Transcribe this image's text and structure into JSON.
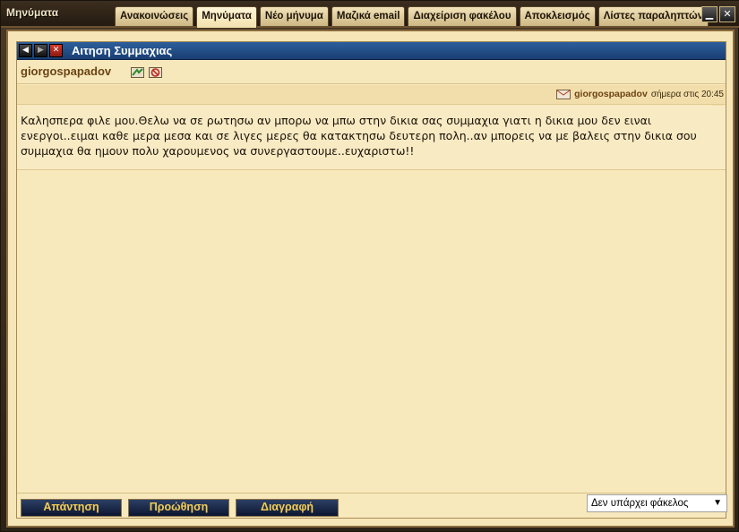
{
  "window": {
    "title": "Μηνύματα"
  },
  "tabs": [
    {
      "label": "Ανακοινώσεις"
    },
    {
      "label": "Μηνύματα",
      "active": true
    },
    {
      "label": "Νέο μήνυμα"
    },
    {
      "label": "Μαζικά email"
    },
    {
      "label": "Διαχείριση φακέλου"
    },
    {
      "label": "Αποκλεισμός"
    },
    {
      "label": "Λίστες παραληπτών"
    }
  ],
  "message": {
    "subject": "Αιτηση Συμμαχιας",
    "sender": "giorgospapadov",
    "post": {
      "author": "giorgospapadov",
      "time": "σήμερα στις 20:45",
      "body": "Καλησπερα φιλε μου.Θελω να σε ρωτησω αν μπορω να μπω στην δικια σας συμμαχια γιατι η δικια μου δεν ειναι ενεργοι..ειμαι καθε μερα μεσα και σε λιγες μερες θα κατακτησω δευτερη πολη..αν μπορεις να με βαλεις στην δικια σου συμμαχια θα ημουν πολυ χαρουμενος να συνεργαστουμε..ευχαριστω!!"
    }
  },
  "actions": {
    "reply": "Απάντηση",
    "forward": "Προώθηση",
    "delete": "Διαγραφή"
  },
  "folder_select": {
    "value": "Δεν υπάρχει φάκελος"
  },
  "colors": {
    "parchment": "#f8e9bd",
    "header_blue": "#1a3e72",
    "button_text": "#f3cc54",
    "author_brown": "#6b4414"
  }
}
